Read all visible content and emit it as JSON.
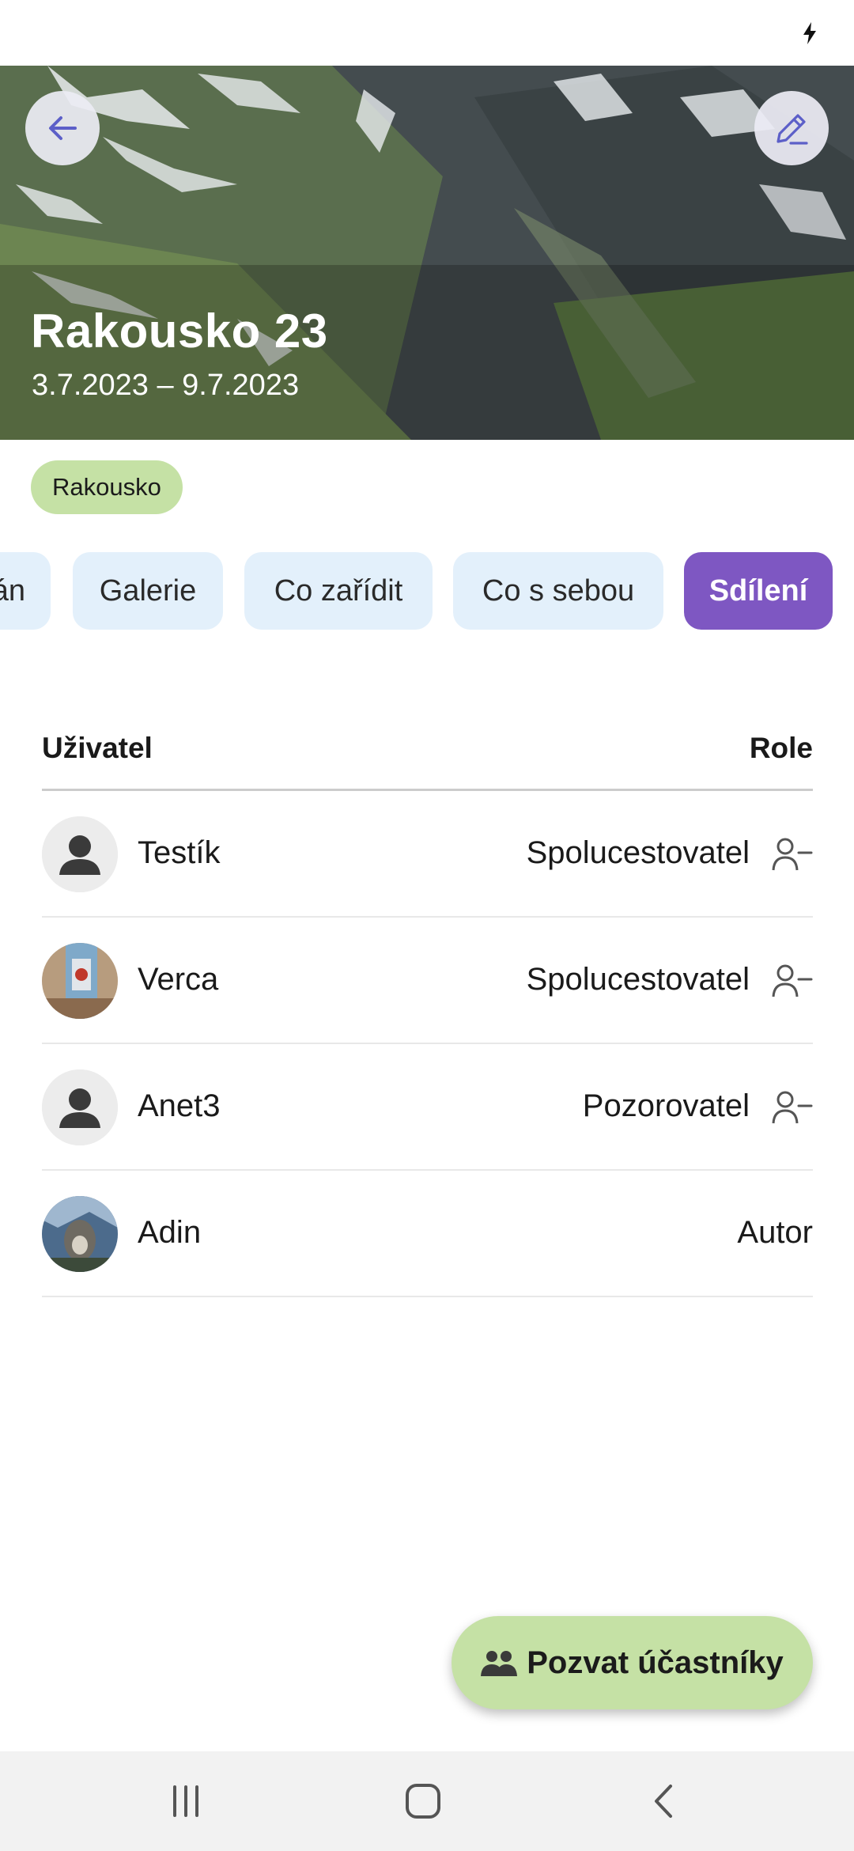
{
  "trip": {
    "title": "Rakousko 23",
    "dates": "3.7.2023 – 9.7.2023",
    "country_tag": "Rakousko"
  },
  "header": {
    "back_icon": "arrow-left-icon",
    "edit_icon": "pencil-icon"
  },
  "tabs": [
    {
      "label": "Plán",
      "visible_label": "án",
      "active": false
    },
    {
      "label": "Galerie",
      "active": false
    },
    {
      "label": "Co zařídit",
      "active": false
    },
    {
      "label": "Co s sebou",
      "active": false
    },
    {
      "label": "Sdílení",
      "active": true
    }
  ],
  "sharing_table": {
    "col_user": "Uživatel",
    "col_role": "Role",
    "rows": [
      {
        "name": "Testík",
        "role": "Spolucestovatel",
        "removable": true,
        "avatar": "default-person-avatar"
      },
      {
        "name": "Verca",
        "role": "Spolucestovatel",
        "removable": true,
        "avatar": "photo-avatar"
      },
      {
        "name": "Anet3",
        "role": "Pozorovatel",
        "removable": true,
        "avatar": "default-person-avatar"
      },
      {
        "name": "Adin",
        "role": "Autor",
        "removable": false,
        "avatar": "photo-avatar"
      }
    ]
  },
  "fab": {
    "label": "Pozvat účastníky",
    "icon": "group-icon"
  },
  "colors": {
    "accent_purple": "#7e57c2",
    "chip_green": "#c5e1a5",
    "tab_inactive": "#e3f0fb",
    "icon_purple": "#5c5fc8"
  },
  "navbar": {
    "icons": [
      "recent-apps-icon",
      "home-icon",
      "back-icon"
    ]
  }
}
